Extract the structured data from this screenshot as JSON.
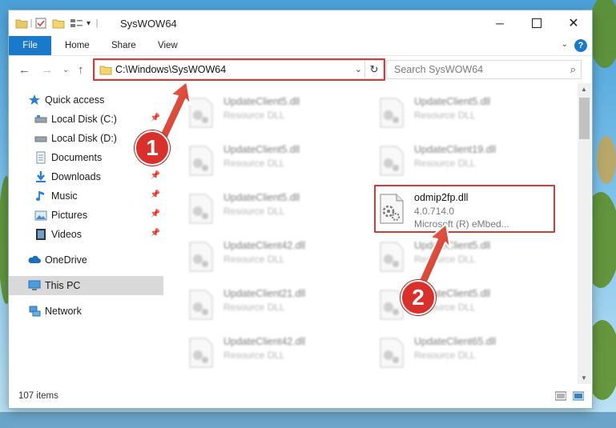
{
  "window": {
    "title": "SysWOW64"
  },
  "ribbon": {
    "file_tab": "File",
    "tabs": [
      "Home",
      "Share",
      "View"
    ],
    "help_label": "?"
  },
  "navbar": {
    "address_path": "C:\\Windows\\SysWOW64",
    "search_placeholder": "Search SysWOW64"
  },
  "sidebar": {
    "items": [
      {
        "label": "Quick access",
        "icon": "star-icon"
      },
      {
        "label": "Local Disk (C:)",
        "icon": "drive-icon"
      },
      {
        "label": "Local Disk (D:)",
        "icon": "drive-icon"
      },
      {
        "label": "Documents",
        "icon": "documents-icon"
      },
      {
        "label": "Downloads",
        "icon": "download-icon"
      },
      {
        "label": "Music",
        "icon": "music-icon"
      },
      {
        "label": "Pictures",
        "icon": "pictures-icon"
      },
      {
        "label": "Videos",
        "icon": "videos-icon"
      },
      {
        "label": "OneDrive",
        "icon": "cloud-icon"
      },
      {
        "label": "This PC",
        "icon": "computer-icon"
      },
      {
        "label": "Network",
        "icon": "network-icon"
      }
    ]
  },
  "files": {
    "left_column": [
      {
        "name": "UpdateClient5.dll",
        "type": "Resource DLL"
      },
      {
        "name": "UpdateClient5.dll",
        "type": "Resource DLL"
      },
      {
        "name": "UpdateClient5.dll",
        "type": "Resource DLL"
      },
      {
        "name": "UpdateClient42.dll",
        "type": "Resource DLL"
      },
      {
        "name": "UpdateClient21.dll",
        "type": "Resource DLL"
      },
      {
        "name": "UpdateClient42.dll",
        "type": "Resource DLL"
      }
    ],
    "right_column": [
      {
        "name": "UpdateClient5.dll",
        "type": "Resource DLL"
      },
      {
        "name": "UpdateClient19.dll",
        "type": "Resource DLL"
      },
      {
        "name": "odmip2fp.dll",
        "version": "4.0.714.0",
        "description": "Microsoft (R) eMbed..."
      },
      {
        "name": "UpdateClient5.dll",
        "type": "Resource DLL"
      },
      {
        "name": "UpdateClient5.dll",
        "type": "Resource DLL"
      },
      {
        "name": "UpdateClient65.dll",
        "type": "Resource DLL"
      }
    ]
  },
  "status": {
    "item_count": "107 items"
  },
  "annotations": {
    "step1": "1",
    "step2": "2"
  },
  "colors": {
    "accent": "#1979ca",
    "highlight": "#d33a3a",
    "arrow": "#e0453a"
  }
}
